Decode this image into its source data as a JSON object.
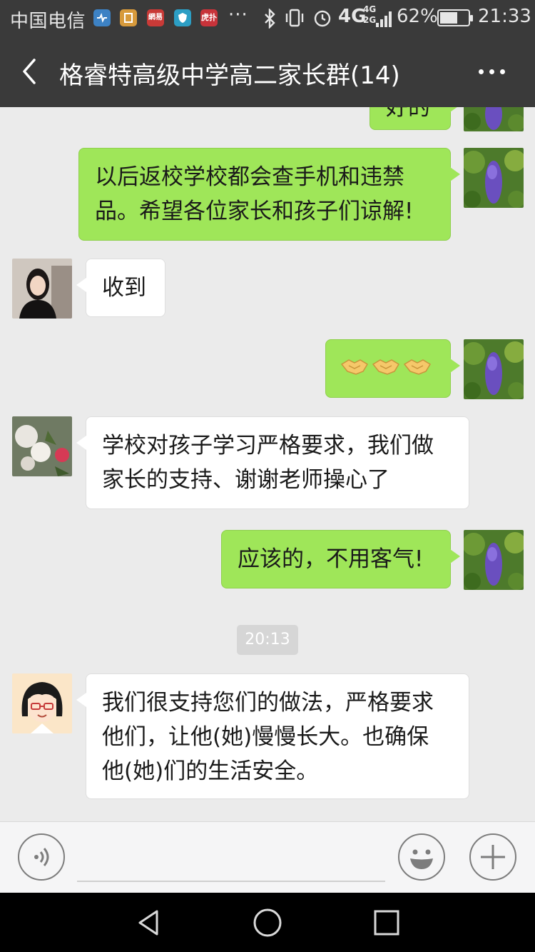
{
  "status_bar": {
    "carrier": "中国电信",
    "app_badges": [
      {
        "icon": "health-app-icon",
        "color": "#3d82c4",
        "label": ""
      },
      {
        "icon": "wallet-app-icon",
        "color": "#d79a3c",
        "label": ""
      },
      {
        "icon": "netease-app-icon",
        "color": "#c93a37",
        "label": "網易"
      },
      {
        "icon": "shield-app-icon",
        "color": "#2c9ec4",
        "label": ""
      },
      {
        "icon": "hupu-app-icon",
        "color": "#c8333a",
        "label": "虎扑"
      }
    ],
    "overflow": "···",
    "network": "4G",
    "network_small": "4G 2G",
    "battery_text": "62%",
    "battery_level": 0.62,
    "time": "21:33"
  },
  "header": {
    "title": "格睿特高级中学高二家长群(14)",
    "back_icon": "chevron-left-icon",
    "more_icon": "more-dots-icon"
  },
  "messages": [
    {
      "side": "mine",
      "text": "好的",
      "partial": true
    },
    {
      "side": "mine",
      "text": "以后返校学校都会查手机和违禁\n品。希望各位家长和孩子们谅解!"
    },
    {
      "side": "theirs",
      "avatar": "woman-photo-avatar",
      "text": "收到"
    },
    {
      "side": "mine",
      "text": "🤝🤝🤝"
    },
    {
      "side": "theirs",
      "avatar": "flowers-photo-avatar",
      "text": "学校对孩子学习严格要求，我们做\n家长的支持、谢谢老师操心了"
    },
    {
      "side": "mine",
      "text": "应该的，不用客气!"
    },
    {
      "side": "theirs",
      "avatar": "cartoon-girl-avatar",
      "text": "我们很支持您们的做法，严格要求\n他们，让他(她)慢慢长大。也确保\n他(她)们的生活安全。"
    }
  ],
  "timestamp": "20:13",
  "input_bar": {
    "voice_icon": "voice-icon",
    "emoji_icon": "emoji-icon",
    "plus_icon": "plus-icon",
    "value": ""
  },
  "nav_bar": {
    "back_icon": "nav-back-icon",
    "home_icon": "nav-home-icon",
    "recents_icon": "nav-recents-icon"
  },
  "colors": {
    "header_bg": "#3a3a3a",
    "chat_bg": "#ebebeb",
    "my_bubble": "#9fe659",
    "their_bubble": "#ffffff"
  }
}
